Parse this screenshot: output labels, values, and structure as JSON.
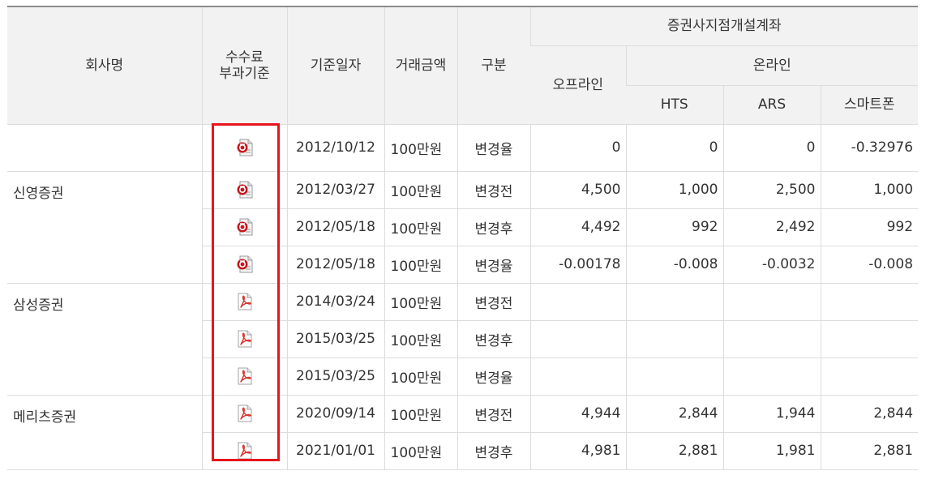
{
  "header": {
    "company": "회사명",
    "fee_basis_line1": "수수료",
    "fee_basis_line2": "부과기준",
    "base_date": "기준일자",
    "trade_amount": "거래금액",
    "category": "구분",
    "branch_account": "증권사지점개설계좌",
    "offline": "오프라인",
    "online": "온라인",
    "hts": "HTS",
    "ars": "ARS",
    "smartphone": "스마트폰"
  },
  "rows": [
    {
      "company": "",
      "doc_icon": "hwp-file-icon",
      "date": "2012/10/12",
      "amount": "100만원",
      "kind": "변경율",
      "offline": "0",
      "hts": "0",
      "ars": "0",
      "smartphone": "-0.32976"
    },
    {
      "company": "신영증권",
      "doc_icon": "hwp-file-icon",
      "date": "2012/03/27",
      "amount": "100만원",
      "kind": "변경전",
      "offline": "4,500",
      "hts": "1,000",
      "ars": "2,500",
      "smartphone": "1,000"
    },
    {
      "company": "",
      "doc_icon": "hwp-file-icon",
      "date": "2012/05/18",
      "amount": "100만원",
      "kind": "변경후",
      "offline": "4,492",
      "hts": "992",
      "ars": "2,492",
      "smartphone": "992"
    },
    {
      "company": "",
      "doc_icon": "hwp-file-icon",
      "date": "2012/05/18",
      "amount": "100만원",
      "kind": "변경율",
      "offline": "-0.00178",
      "hts": "-0.008",
      "ars": "-0.0032",
      "smartphone": "-0.008"
    },
    {
      "company": "삼성증권",
      "doc_icon": "pdf-file-icon",
      "date": "2014/03/24",
      "amount": "100만원",
      "kind": "변경전",
      "offline": "",
      "hts": "",
      "ars": "",
      "smartphone": ""
    },
    {
      "company": "",
      "doc_icon": "pdf-file-icon",
      "date": "2015/03/25",
      "amount": "100만원",
      "kind": "변경후",
      "offline": "",
      "hts": "",
      "ars": "",
      "smartphone": ""
    },
    {
      "company": "",
      "doc_icon": "pdf-file-icon",
      "date": "2015/03/25",
      "amount": "100만원",
      "kind": "변경율",
      "offline": "",
      "hts": "",
      "ars": "",
      "smartphone": ""
    },
    {
      "company": "메리츠증권",
      "doc_icon": "pdf-file-icon",
      "date": "2020/09/14",
      "amount": "100만원",
      "kind": "변경전",
      "offline": "4,944",
      "hts": "2,844",
      "ars": "1,944",
      "smartphone": "2,844"
    },
    {
      "company": "",
      "doc_icon": "pdf-file-icon",
      "date": "2021/01/01",
      "amount": "100만원",
      "kind": "변경후",
      "offline": "4,981",
      "hts": "2,881",
      "ars": "1,981",
      "smartphone": "2,881"
    }
  ],
  "colors": {
    "header_bg": "#f2f2f2",
    "grid_line": "#dcdcdc",
    "highlight": "#e8141c",
    "hwp_icon": "#c8161d",
    "pdf_icon": "#d9302b"
  }
}
